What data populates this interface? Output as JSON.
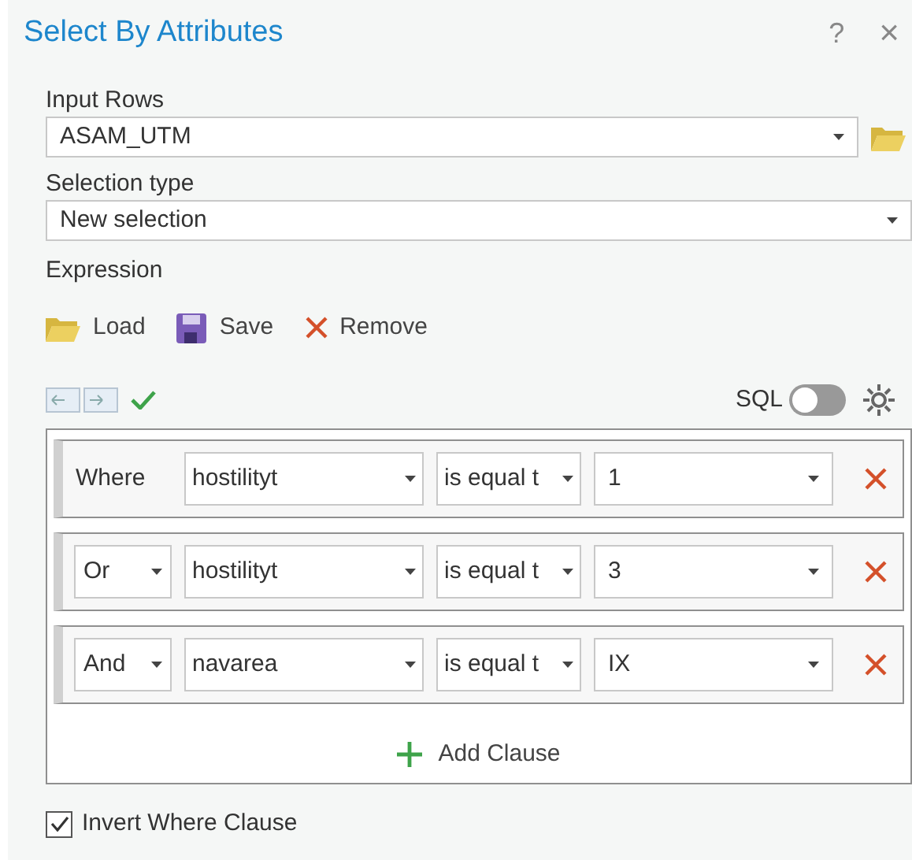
{
  "window": {
    "title": "Select By Attributes",
    "help": "?",
    "close": "×"
  },
  "input_rows": {
    "label": "Input Rows",
    "value": "ASAM_UTM"
  },
  "selection_type": {
    "label": "Selection type",
    "value": "New selection"
  },
  "expression": {
    "label": "Expression",
    "actions": [
      "Load",
      "Save",
      "Remove"
    ],
    "valid": true,
    "sql": {
      "label": "SQL",
      "on": false
    }
  },
  "clauses": [
    {
      "kind": "where",
      "connector": "Where",
      "field": "hostilityt",
      "operator": "is equal t",
      "value": "1"
    },
    {
      "kind": "connector",
      "connector": "Or",
      "field": "hostilityt",
      "operator": "is equal t",
      "value": "3"
    },
    {
      "kind": "connector",
      "connector": "And",
      "field": "navarea",
      "operator": "is equal t",
      "value": "IX"
    }
  ],
  "add_clause": "Add Clause",
  "invert": {
    "label": "Invert Where Clause",
    "checked": true
  }
}
